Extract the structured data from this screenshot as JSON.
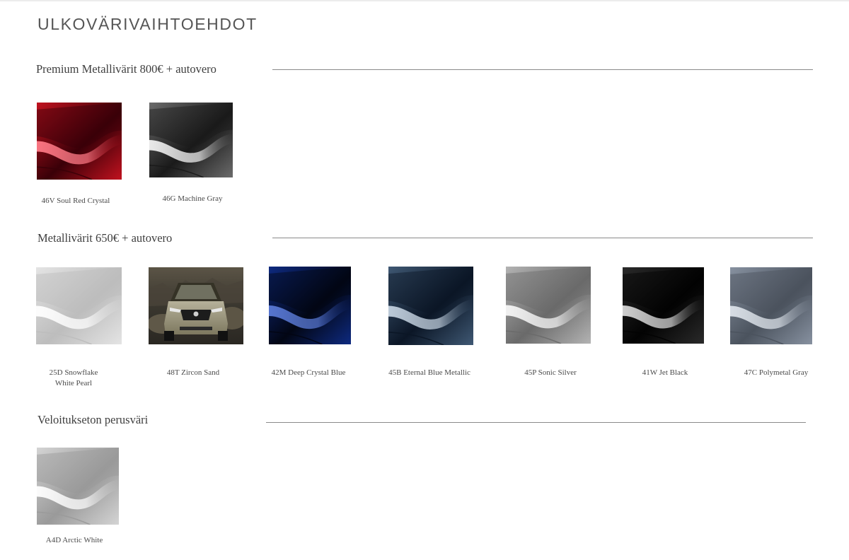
{
  "page": {
    "title": "ULKOVÄRIVAIHTOEHDOT"
  },
  "sections": [
    {
      "title": "Premium Metallivärit 800€ + autovero",
      "colors": [
        {
          "code_name": "46V Soul Red Crystal",
          "swatch": {
            "base": "#3a0008",
            "mid": "#c1121f",
            "highlight": "#ff7a86"
          }
        },
        {
          "code_name": "46G Machine Gray",
          "swatch": {
            "base": "#1a1a1a",
            "mid": "#6b6b6b",
            "highlight": "#f2f2f2"
          }
        }
      ]
    },
    {
      "title": "Metallivärit 650€ + autovero",
      "colors": [
        {
          "code_name_line1": "25D Snowflake",
          "code_name_line2": "White Pearl",
          "swatch": {
            "base": "#bdbdbd",
            "mid": "#e4e4e4",
            "highlight": "#ffffff"
          }
        },
        {
          "code_name": "48T Zircon Sand",
          "swatch": {
            "base": "#3d3a2f",
            "mid": "#8f8a72",
            "highlight": "#c9c4ae"
          },
          "kind": "car-photo"
        },
        {
          "code_name": "42M Deep Crystal Blue",
          "swatch": {
            "base": "#020614",
            "mid": "#0e2a80",
            "highlight": "#5a7ad6"
          }
        },
        {
          "code_name": "45B Eternal Blue Metallic",
          "swatch": {
            "base": "#0b1626",
            "mid": "#3f5873",
            "highlight": "#c4d2e0"
          }
        },
        {
          "code_name": "45P Sonic Silver",
          "swatch": {
            "base": "#6a6a6a",
            "mid": "#b3b3b3",
            "highlight": "#f7f7f7"
          }
        },
        {
          "code_name": "41W Jet Black",
          "swatch": {
            "base": "#030303",
            "mid": "#2a2a2a",
            "highlight": "#d8d8d8"
          }
        },
        {
          "code_name": "47C Polymetal Gray",
          "swatch": {
            "base": "#4b535e",
            "mid": "#8791a0",
            "highlight": "#dde3ea"
          }
        }
      ]
    },
    {
      "title": "Veloitukseton perusväri",
      "colors": [
        {
          "code_name": "A4D Arctic White",
          "swatch": {
            "base": "#9a9a9a",
            "mid": "#d4d4d4",
            "highlight": "#ffffff"
          }
        }
      ]
    }
  ]
}
